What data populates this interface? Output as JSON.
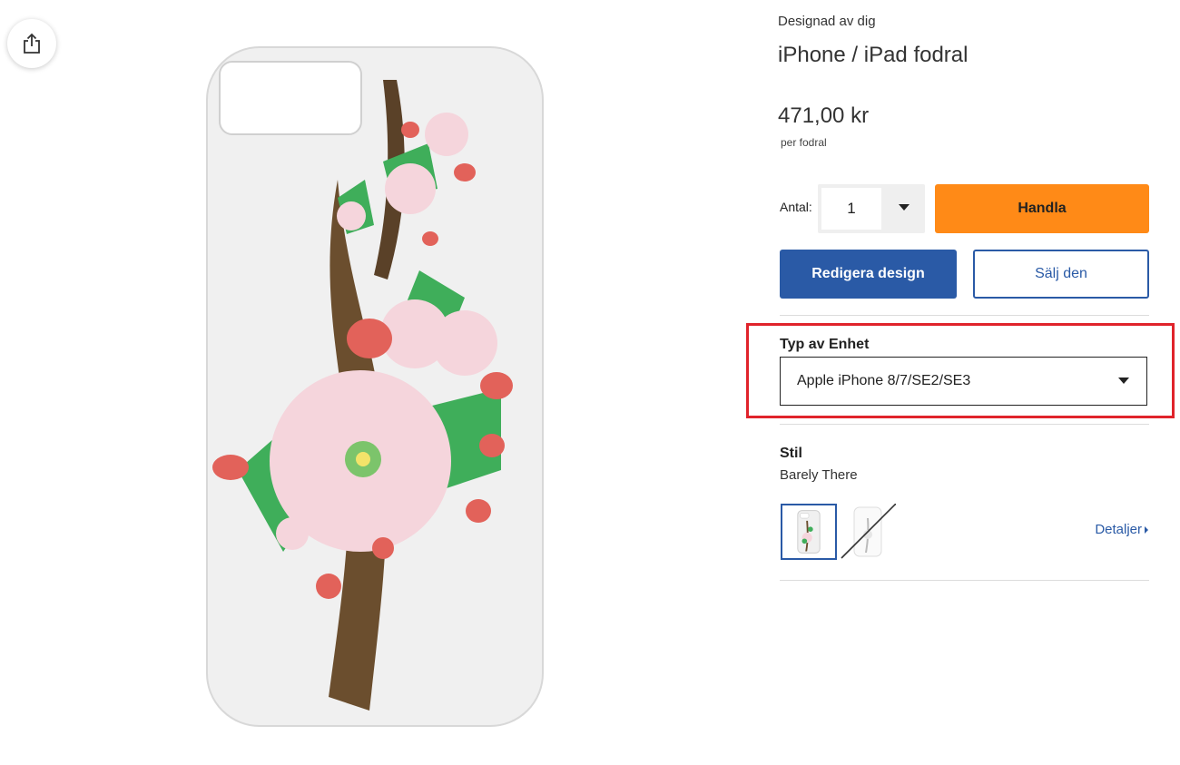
{
  "toolbar": {
    "share_icon": "share-icon"
  },
  "product": {
    "eyebrow": "Designad av dig",
    "title": "iPhone / iPad fodral",
    "price": "471,00 kr",
    "price_unit": "per fodral"
  },
  "quantity": {
    "label": "Antal:",
    "value": "1"
  },
  "buttons": {
    "buy": "Handla",
    "edit": "Redigera design",
    "sell": "Sälj den"
  },
  "device": {
    "label": "Typ av Enhet",
    "selected": "Apple iPhone 8/7/SE2/SE3"
  },
  "style": {
    "label": "Stil",
    "value": "Barely There",
    "details": "Detaljer"
  },
  "colors": {
    "accent": "#2a5aa6",
    "buy": "#ff8a17",
    "highlight": "#e0232b"
  }
}
